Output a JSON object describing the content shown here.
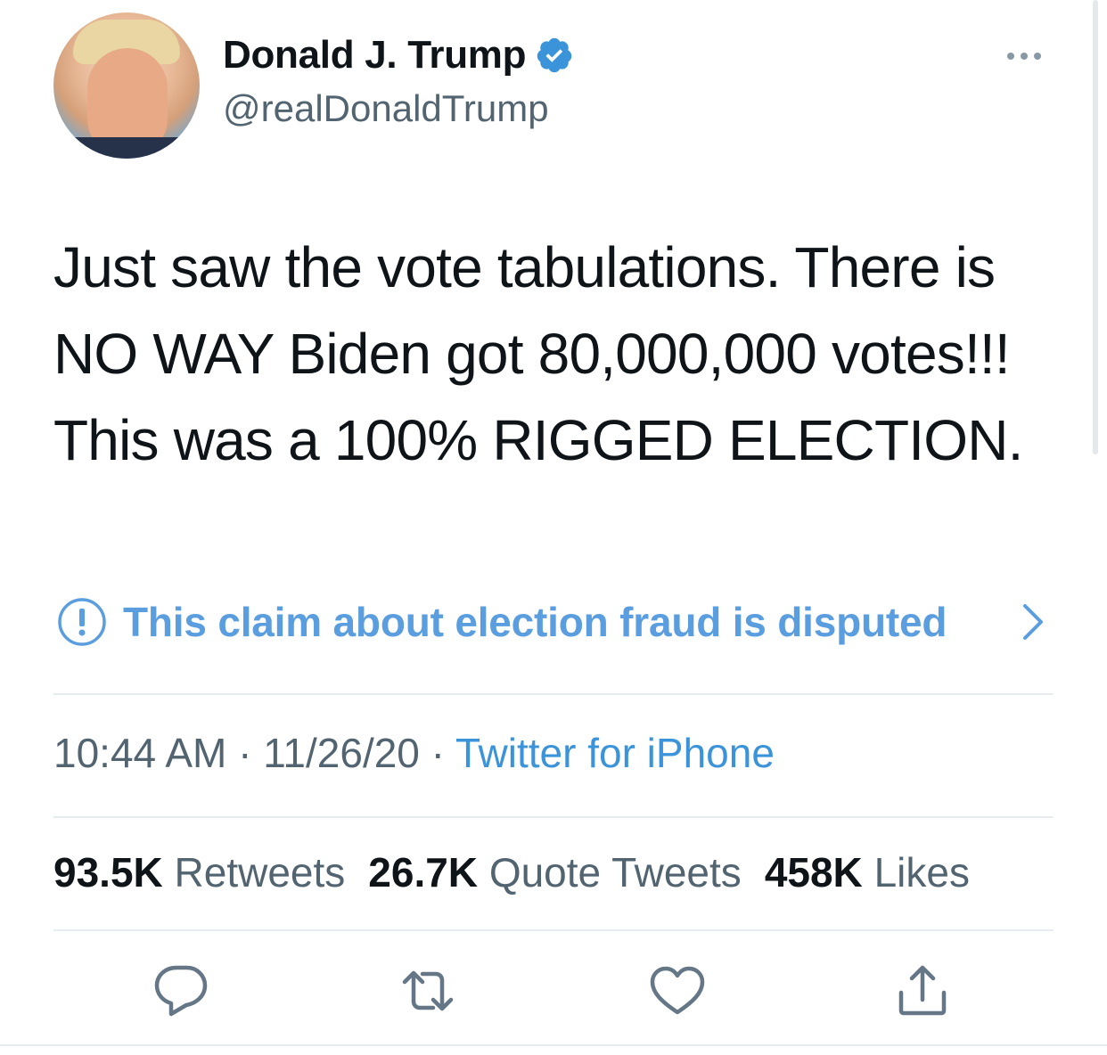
{
  "author": {
    "name": "Donald J. Trump",
    "handle": "@realDonaldTrump",
    "verified": true
  },
  "tweet": {
    "text": "Just saw the vote tabulations. There is NO WAY Biden got 80,000,000 votes!!! This was a 100% RIGGED ELECTION."
  },
  "notice": {
    "label": "This claim about election fraud is disputed",
    "icon": "exclamation-circle-icon"
  },
  "meta": {
    "time": "10:44 AM",
    "separator": " · ",
    "date": "11/26/20",
    "source": "Twitter for iPhone"
  },
  "stats": {
    "retweets_count": "93.5K",
    "retweets_label": "Retweets",
    "quotes_count": "26.7K",
    "quotes_label": "Quote Tweets",
    "likes_count": "458K",
    "likes_label": "Likes"
  },
  "actions": [
    "reply-icon",
    "retweet-icon",
    "like-icon",
    "share-icon"
  ],
  "colors": {
    "link": "#3b94d9",
    "notice": "#5b9ee0",
    "verified": "#3b94d9",
    "secondary_text": "#536471",
    "icon": "#657786"
  }
}
